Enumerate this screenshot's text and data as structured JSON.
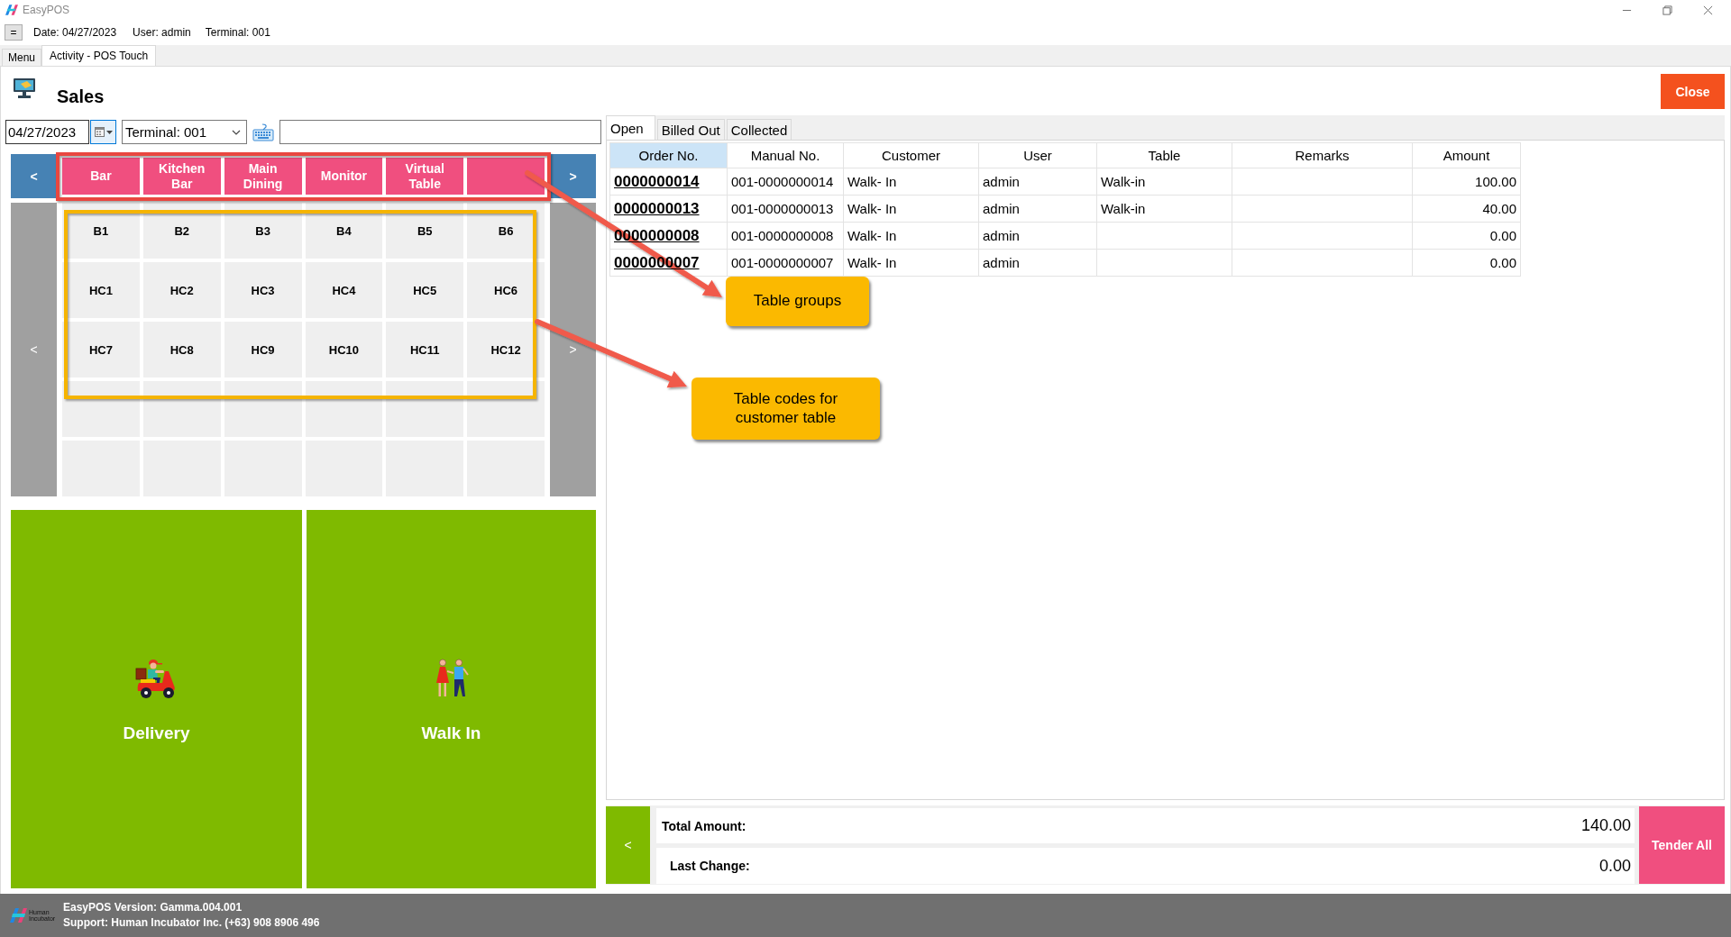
{
  "window": {
    "title": "EasyPOS"
  },
  "info_bar": {
    "menu_button": "=",
    "date": "Date: 04/27/2023",
    "user": "User: admin",
    "terminal": "Terminal: 001"
  },
  "module_tabs": [
    {
      "label": "Menu",
      "selected": false
    },
    {
      "label": "Activity - POS Touch",
      "selected": true
    }
  ],
  "header": {
    "title": "Sales",
    "close_button": "Close"
  },
  "filters": {
    "date": "04/27/2023",
    "terminal": "Terminal: 001"
  },
  "table_groups": {
    "previous": "<",
    "next": ">",
    "groups": [
      "Bar",
      "Kitchen Bar",
      "Main Dining",
      "Monitor",
      "Virtual Table"
    ]
  },
  "tables": {
    "previous": "<",
    "next": ">",
    "codes": [
      "B1",
      "B2",
      "B3",
      "B4",
      "B5",
      "B6",
      "HC1",
      "HC2",
      "HC3",
      "HC4",
      "HC5",
      "HC6",
      "HC7",
      "HC8",
      "HC9",
      "HC10",
      "HC11",
      "HC12"
    ]
  },
  "order_types": [
    {
      "kind": "delivery",
      "label": "Delivery"
    },
    {
      "kind": "walk_in",
      "label": "Walk In"
    }
  ],
  "orders": {
    "tabs": [
      {
        "label": "Open",
        "selected": true
      },
      {
        "label": "Billed Out",
        "selected": false
      },
      {
        "label": "Collected",
        "selected": false
      }
    ],
    "columns": [
      {
        "label": "Order No.",
        "selected": true
      },
      {
        "label": "Manual No.",
        "selected": false
      },
      {
        "label": "Customer",
        "selected": false
      },
      {
        "label": "User",
        "selected": false
      },
      {
        "label": "Table",
        "selected": false
      },
      {
        "label": "Remarks",
        "selected": false
      },
      {
        "label": "Amount",
        "selected": false
      }
    ],
    "rows": [
      {
        "order_no": "0000000014",
        "manual_no": "001-0000000014",
        "customer": "Walk- In",
        "user": "admin",
        "table": "Walk-in",
        "amount": "100.00"
      },
      {
        "order_no": "0000000013",
        "manual_no": "001-0000000013",
        "customer": "Walk- In",
        "user": "admin",
        "table": "Walk-in",
        "amount": "40.00"
      },
      {
        "order_no": "0000000008",
        "manual_no": "001-0000000008",
        "customer": "Walk- In",
        "user": "admin",
        "amount": "0.00"
      },
      {
        "order_no": "0000000007",
        "manual_no": "001-0000000007",
        "customer": "Walk- In",
        "user": "admin",
        "amount": "0.00"
      }
    ]
  },
  "totals": {
    "back": "<",
    "total_label": "Total Amount:",
    "total": "140.00",
    "change_label": "Last Change:",
    "change": "0.00",
    "tender_button": "Tender All"
  },
  "callouts": [
    "Table groups",
    "Table codes for customer table"
  ],
  "footer": {
    "logo_text": "Human Incubator",
    "version": "EasyPOS Version: Gamma.004.001",
    "support": "Support: Human Incubator Inc. (+63) 908 8906 496"
  }
}
